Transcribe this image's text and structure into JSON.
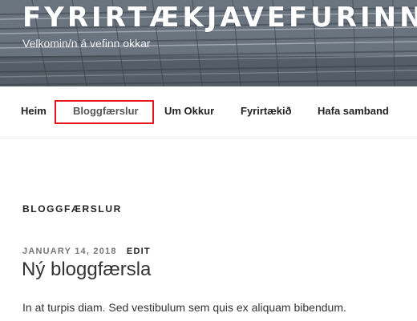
{
  "header": {
    "site_title": "FYRIRTÆKJAVEFURINN MI",
    "tagline": "Velkomin/n á vefinn okkar"
  },
  "nav": {
    "items": [
      {
        "label": "Heim"
      },
      {
        "label": "Bloggfærslur",
        "active": true
      },
      {
        "label": "Um Okkur"
      },
      {
        "label": "Fyrirtækið"
      },
      {
        "label": "Hafa samband"
      }
    ],
    "highlight_color": "#e8141c"
  },
  "main": {
    "section_title": "BLOGGFÆRSLUR",
    "post": {
      "date": "JANUARY 14, 2018",
      "edit_label": "EDIT",
      "title": "Ný bloggfærsla",
      "excerpt": "In at turpis diam. Sed vestibulum sem quis ex aliquam bibendum."
    }
  }
}
